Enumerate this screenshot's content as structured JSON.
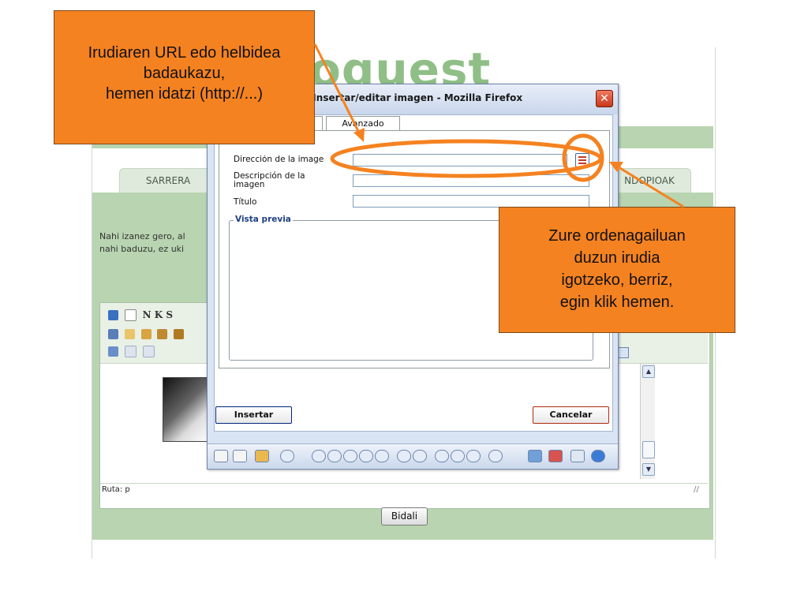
{
  "site": {
    "logo_text": "oquest",
    "tabs": [
      {
        "label": "SARRERA"
      },
      {
        "label": "NDOPIOAK"
      }
    ],
    "intro_text_line1": "Nahi izanez gero, al",
    "intro_text_line2": "nahi baduzu, ez uki",
    "editor": {
      "toolbar_row1": "N  K  S",
      "status_path": "Ruta: p"
    },
    "submit_label": "Bidali"
  },
  "dialog": {
    "title": "oques.org - Insertar/editar imagen - Mozilla Firefox",
    "close_glyph": "✕",
    "tabs": [
      {
        "label": ""
      },
      {
        "label": "Avanzado"
      }
    ],
    "fields": {
      "image_url_label": "Dirección de la image",
      "description_label_1": "Descripción de la",
      "description_label_2": "imagen",
      "title_label": "Título",
      "image_url_value": "",
      "description_value": "",
      "title_value": ""
    },
    "preview_legend": "Vista previa",
    "insert_label": "Insertar",
    "cancel_label": "Cancelar"
  },
  "callouts": {
    "url_hint_line1": "Irudiaren URL edo helbidea",
    "url_hint_line2": "badaukazu,",
    "url_hint_line3": "hemen idatzi (http://...)",
    "upload_hint_line1": "Zure ordenagailuan",
    "upload_hint_line2": "duzun irudia",
    "upload_hint_line3": "igotzeko, berriz,",
    "upload_hint_line4": "egin klik hemen."
  },
  "colors": {
    "callout_fill": "#f58220",
    "highlight_ring": "#f58220",
    "page_green": "#b8d4b0",
    "logo_green": "#8fbf86"
  },
  "icons": [
    "browse-images-icon",
    "save-icon",
    "new-document-icon",
    "bold-icon",
    "italic-icon",
    "underline-icon",
    "cut-icon",
    "copy-icon",
    "paste-icon",
    "scroll-up-icon",
    "scroll-down-icon",
    "resize-grip-icon",
    "close-icon"
  ]
}
